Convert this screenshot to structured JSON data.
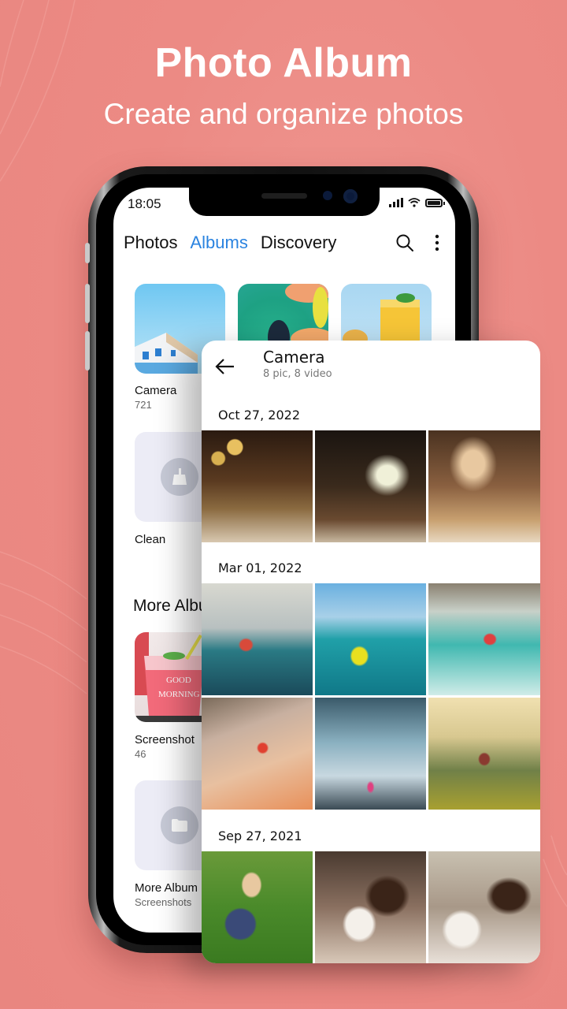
{
  "hero": {
    "title": "Photo Album",
    "subtitle": "Create and organize photos"
  },
  "status_bar": {
    "time": "18:05",
    "icons": [
      "signal-icon",
      "wifi-icon",
      "battery-icon"
    ]
  },
  "top_nav": {
    "tabs": [
      {
        "label": "Photos",
        "active": false
      },
      {
        "label": "Albums",
        "active": true
      },
      {
        "label": "Discovery",
        "active": false
      }
    ],
    "actions": [
      "search-icon",
      "more-vertical-icon"
    ],
    "accent_color": "#2a83e0"
  },
  "albums": [
    {
      "name": "Camera",
      "count": "721",
      "thumb": "building"
    },
    {
      "name": "",
      "count": "",
      "thumb": "butterfly"
    },
    {
      "name": "",
      "count": "",
      "thumb": "juice"
    }
  ],
  "tools": [
    {
      "name": "Clean",
      "icon": "broom-icon"
    }
  ],
  "more_albums": {
    "title": "More Albu",
    "items": [
      {
        "name": "Screenshot",
        "count": "46",
        "thumb": "good-morning-drink"
      },
      {
        "name": "More Album",
        "count": "Screenshots",
        "icon": "folder-icon"
      }
    ]
  },
  "album_detail": {
    "title": "Camera",
    "subtitle": "8 pic, 8 video",
    "groups": [
      {
        "date": "Oct 27, 2022",
        "photos": [
          "dinner-wine",
          "party-sparklers",
          "family-dinner"
        ]
      },
      {
        "date": "Mar 01, 2022",
        "photos": [
          "kayak-cliffs",
          "kayak-yellow",
          "kayak-rapids",
          "rock-climber",
          "waterfall",
          "hikers"
        ]
      },
      {
        "date": "Sep 27, 2021",
        "photos": [
          "toddler-flowers",
          "mother-daughter-kiss",
          "mother-daughter-play"
        ]
      }
    ]
  },
  "colors": {
    "background": "#ec8a84",
    "accent": "#2a83e0"
  }
}
